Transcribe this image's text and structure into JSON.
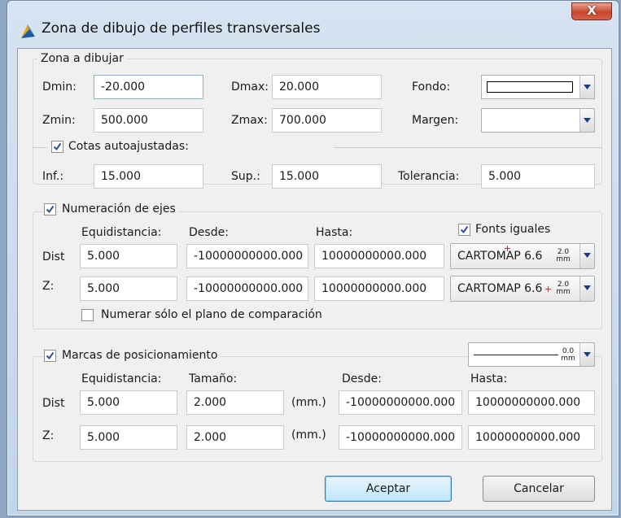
{
  "window": {
    "title": "Zona de dibujo de perfiles transversales",
    "close_label": "X"
  },
  "zona": {
    "title": "Zona a dibujar",
    "dmin_label": "Dmin:",
    "dmin": "-20.000",
    "dmax_label": "Dmax:",
    "dmax": "20.000",
    "fondo_label": "Fondo:",
    "zmin_label": "Zmin:",
    "zmin": "500.000",
    "zmax_label": "Zmax:",
    "zmax": "700.000",
    "margen_label": "Margen:"
  },
  "cotas": {
    "label": "Cotas autoajustadas:",
    "checked": true,
    "inf_label": "Inf.:",
    "inf": "15.000",
    "sup_label": "Sup.:",
    "sup": "15.000",
    "tol_label": "Tolerancia:",
    "tol": "5.000"
  },
  "numeracion": {
    "label": "Numeración de ejes",
    "checked": true,
    "col_equid": "Equidistancia:",
    "col_desde": "Desde:",
    "col_hasta": "Hasta:",
    "fonts_label": "Fonts iguales",
    "fonts_checked": true,
    "dist_label": "Dist",
    "dist_equid": "5.000",
    "dist_desde": "-10000000000.000",
    "dist_hasta": "10000000000.000",
    "dist_font": "CARTOMAP 6.6",
    "dist_size": "2.0",
    "dist_unit": "mm",
    "z_label": "Z:",
    "z_equid": "5.000",
    "z_desde": "-10000000000.000",
    "z_hasta": "10000000000.000",
    "z_font": "CARTOMAP 6.6",
    "z_size": "2.0",
    "z_unit": "mm",
    "numerar_label": "Numerar sólo el plano de comparación",
    "numerar_checked": false
  },
  "marcas": {
    "label": "Marcas de posicionamiento",
    "checked": true,
    "line_size": "0.0",
    "line_unit": "mm",
    "col_equid": "Equidistancia:",
    "col_tamano": "Tamaño:",
    "col_desde": "Desde:",
    "col_hasta": "Hasta:",
    "dist_label": "Dist",
    "dist_equid": "5.000",
    "dist_tamano": "2.000",
    "dist_unit": "(mm.)",
    "dist_desde": "-10000000000.000",
    "dist_hasta": "10000000000.000",
    "z_label": "Z:",
    "z_equid": "5.000",
    "z_tamano": "2.000",
    "z_unit": "(mm.)",
    "z_desde": "-10000000000.000",
    "z_hasta": "10000000000.000"
  },
  "buttons": {
    "accept": "Aceptar",
    "cancel": "Cancelar"
  }
}
